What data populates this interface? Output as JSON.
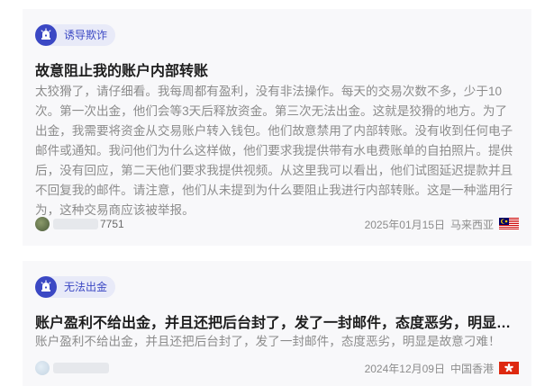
{
  "posts": [
    {
      "tag": "诱导欺诈",
      "title": "故意阻止我的账户内部转账",
      "body": "太狡猾了，请仔细看。我每周都有盈利，没有非法操作。每天的交易次数不多，少于10次。第一次出金，他们会等3天后释放资金。第三次无法出金。这就是狡猾的地方。为了出金，我需要将资金从交易账户转入钱包。他们故意禁用了内部转账。没有收到任何电子邮件或通知。我问他们为什么这样做，他们要求我提供带有水电费账单的自拍照片。提供后，没有回应，第二天他们要求我提供视频。从这里我可以看出，他们试图延迟提款并且不回复我的邮件。请注意，他们从未提到为什么要阻止我进行内部转账。这是一种滥用行为，这种交易商应该被举报。",
      "username_visible": "7751",
      "date": "2025年01月15日",
      "region": "马来西亚",
      "flag_icon": "malaysia-flag-icon"
    },
    {
      "tag": "无法出金",
      "title": "账户盈利不给出金，并且还把后台封了，发了一封邮件，态度恶劣，明显是故意刁难！",
      "body": "账户盈利不给出金，并且还把后台封了，发了一封邮件，态度恶劣，明显是故意刁难！",
      "username_visible": "",
      "date": "2024年12月09日",
      "region": "中国香港",
      "flag_icon": "hong-kong-flag-icon"
    }
  ],
  "colors": {
    "accent": "#3b48c4",
    "tag_bg": "#e8eaf8",
    "card_bg": "#f8f8fa",
    "muted_text": "#8c8c8c",
    "title_text": "#1e1e1e"
  }
}
